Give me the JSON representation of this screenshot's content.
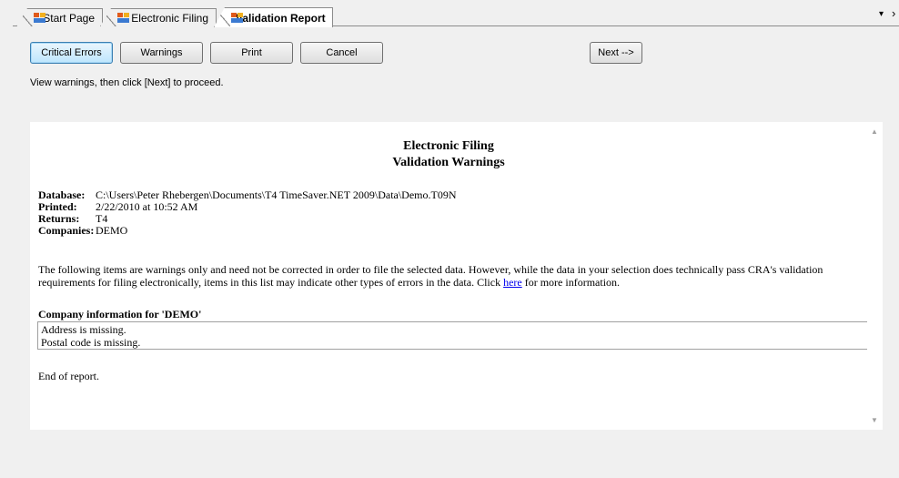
{
  "tabs": [
    {
      "label": "Start Page",
      "active": false,
      "icon": "app-icon"
    },
    {
      "label": "Electronic Filing",
      "active": false,
      "icon": "app-icon"
    },
    {
      "label": "Validation Report",
      "active": true,
      "icon": "app-icon"
    }
  ],
  "tab_nav": {
    "dropdown": "▾",
    "scroll_right": "›"
  },
  "toolbar": {
    "critical_errors": "Critical Errors",
    "warnings": "Warnings",
    "print": "Print",
    "cancel": "Cancel",
    "next": "Next -->"
  },
  "instruction": "View warnings, then click [Next] to proceed.",
  "report": {
    "title_line1": "Electronic Filing",
    "title_line2": "Validation Warnings",
    "meta": [
      {
        "key": "Database:",
        "value": "C:\\Users\\Peter Rhebergen\\Documents\\T4 TimeSaver.NET 2009\\Data\\Demo.T09N"
      },
      {
        "key": "Printed:",
        "value": "2/22/2010 at 10:52 AM"
      },
      {
        "key": "Returns:",
        "value": "T4"
      },
      {
        "key": "Companies:",
        "value": "DEMO"
      }
    ],
    "paragraph_before_link": "The following items are warnings only and need not be corrected in order to file the selected data. However, while the data in your selection does technically pass CRA's validation requirements for filing electronically, items in this list may indicate other types of errors in the data. Click ",
    "link_text": "here",
    "paragraph_after_link": " for more information.",
    "section_title": "Company information for 'DEMO'",
    "section_items": [
      "Address is missing.",
      "Postal code is missing."
    ],
    "end_text": "End of report."
  },
  "colors": {
    "link": "#0000ee",
    "report_bg": "#ffffff",
    "window_bg": "#f0f0f0"
  }
}
